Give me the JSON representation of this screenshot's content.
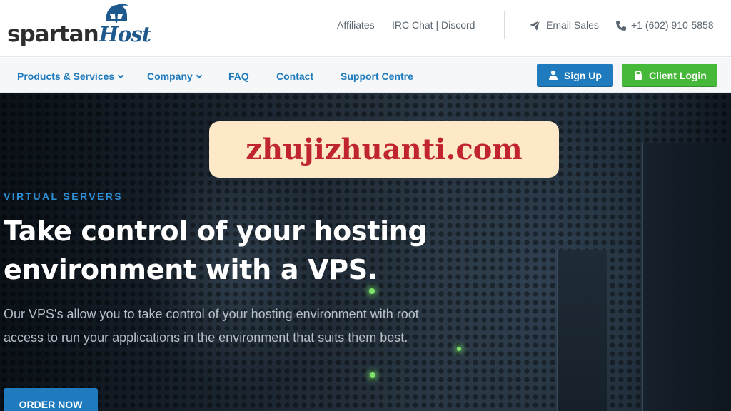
{
  "brand": {
    "name_part1": "spartan",
    "name_part2": "Host"
  },
  "top_links": {
    "affiliates": "Affiliates",
    "irc_discord": "IRC Chat | Discord",
    "email_sales": "Email Sales",
    "phone": "+1 (602) 910-5858"
  },
  "nav": {
    "items": [
      {
        "label": "Products & Services",
        "dropdown": true
      },
      {
        "label": "Company",
        "dropdown": true
      },
      {
        "label": "FAQ",
        "dropdown": false
      },
      {
        "label": "Contact",
        "dropdown": false
      },
      {
        "label": "Support Centre",
        "dropdown": false
      }
    ],
    "signup_label": "Sign Up",
    "login_label": "Client Login"
  },
  "watermark": "zhujizhuanti.com",
  "hero": {
    "eyebrow": "VIRTUAL SERVERS",
    "title": "Take control of your hosting environment with a VPS.",
    "text": "Our VPS's allow you to take control of your hosting environment with root access to run your applications in the environment that suits them best.",
    "cta": "ORDER NOW"
  },
  "colors": {
    "primary_blue": "#1f7bbd",
    "login_green": "#46b93a",
    "eyebrow_blue": "#2f8fd4",
    "watermark_bg": "#fde8c8",
    "watermark_text": "#c0242f"
  },
  "icons": [
    "helmet-logo-icon",
    "paper-plane-icon",
    "phone-icon",
    "chevron-down-icon",
    "user-icon",
    "lock-icon"
  ]
}
